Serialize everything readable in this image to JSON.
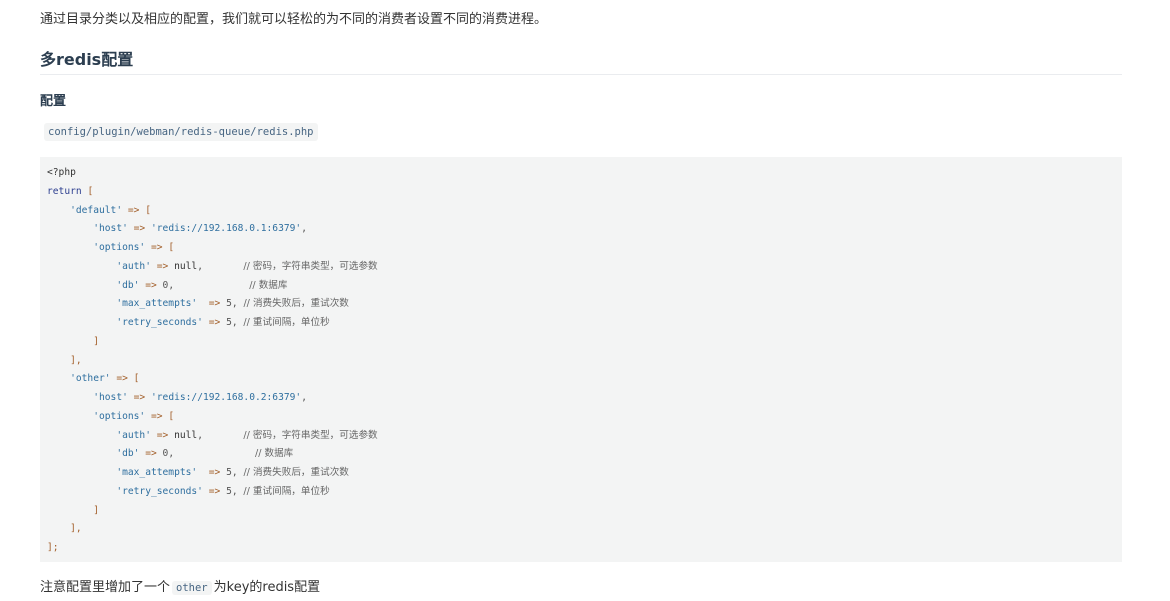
{
  "intro": "通过目录分类以及相应的配置，我们就可以轻松的为不同的消费者设置不同的消费进程。",
  "heading_multi_redis": "多redis配置",
  "heading_config": "配置",
  "config_path": "config/plugin/webman/redis-queue/redis.php",
  "code": {
    "open_tag": "<?php",
    "return_kw": "return",
    "open_bracket": "[",
    "default_key": "'default'",
    "other_key": "'other'",
    "arrow": "=>",
    "host_key": "'host'",
    "host_default": "'redis://192.168.0.1:6379'",
    "host_other": "'redis://192.168.0.2:6379'",
    "options_key": "'options'",
    "auth_key": "'auth'",
    "null_val": "null",
    "db_key": "'db'",
    "db_val": "0",
    "max_attempts_key": "'max_attempts'",
    "max_attempts_val": "5",
    "retry_seconds_key": "'retry_seconds'",
    "retry_seconds_val": "5",
    "comment_auth": "// 密码，字符串类型，可选参数",
    "comment_db": "// 数据库",
    "comment_max_attempts": "// 消费失败后，重试次数",
    "comment_retry_seconds": "// 重试间隔，单位秒",
    "close_inner": "]",
    "close_comma": "],",
    "close_final": "];"
  },
  "note": {
    "before": "注意配置里增加了一个",
    "code": "other",
    "after": "为key的redis配置"
  }
}
